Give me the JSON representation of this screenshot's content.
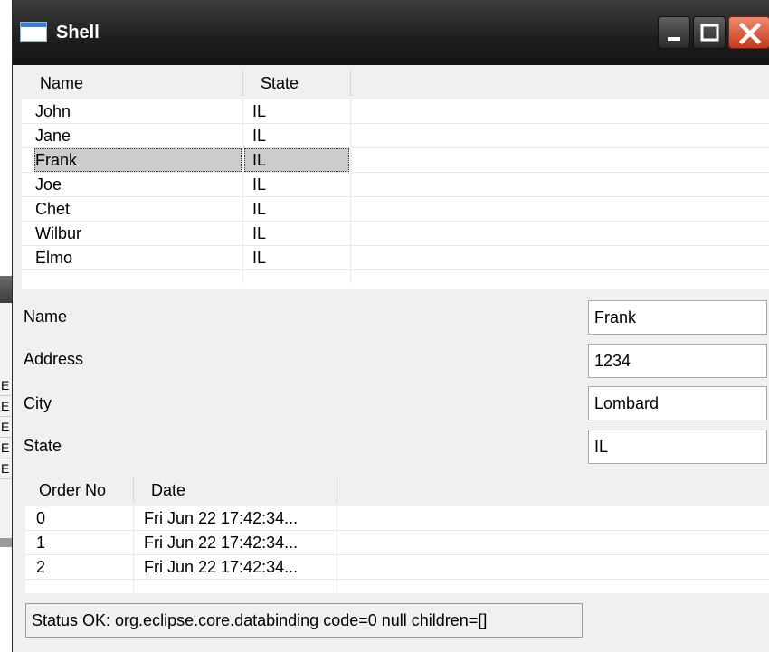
{
  "window": {
    "title": "Shell"
  },
  "background_app": {
    "row_glyphs": [
      "E",
      "E",
      "E",
      "E",
      "E"
    ]
  },
  "people_table": {
    "columns": [
      "Name",
      "State"
    ],
    "rows": [
      {
        "name": "John",
        "state": "IL"
      },
      {
        "name": "Jane",
        "state": "IL"
      },
      {
        "name": "Frank",
        "state": "IL"
      },
      {
        "name": "Joe",
        "state": "IL"
      },
      {
        "name": "Chet",
        "state": "IL"
      },
      {
        "name": "Wilbur",
        "state": "IL"
      },
      {
        "name": "Elmo",
        "state": "IL"
      }
    ],
    "selected_row": "Frank"
  },
  "form": {
    "name": {
      "label": "Name",
      "value": "Frank"
    },
    "address": {
      "label": "Address",
      "value": "1234"
    },
    "city": {
      "label": "City",
      "value": "Lombard"
    },
    "state": {
      "label": "State",
      "value": "IL"
    }
  },
  "orders_table": {
    "columns": [
      "Order No",
      "Date"
    ],
    "rows": [
      {
        "order_no": "0",
        "date": "Fri Jun 22 17:42:34..."
      },
      {
        "order_no": "1",
        "date": "Fri Jun 22 17:42:34..."
      },
      {
        "order_no": "2",
        "date": "Fri Jun 22 17:42:34..."
      }
    ]
  },
  "status": {
    "text": "Status OK: org.eclipse.core.databinding code=0  null children=[]"
  },
  "colors": {
    "title_bar": "#1e1e1e",
    "close_button": "#d9472a",
    "selection": "#cccccc",
    "panel": "#f0f0f0"
  }
}
